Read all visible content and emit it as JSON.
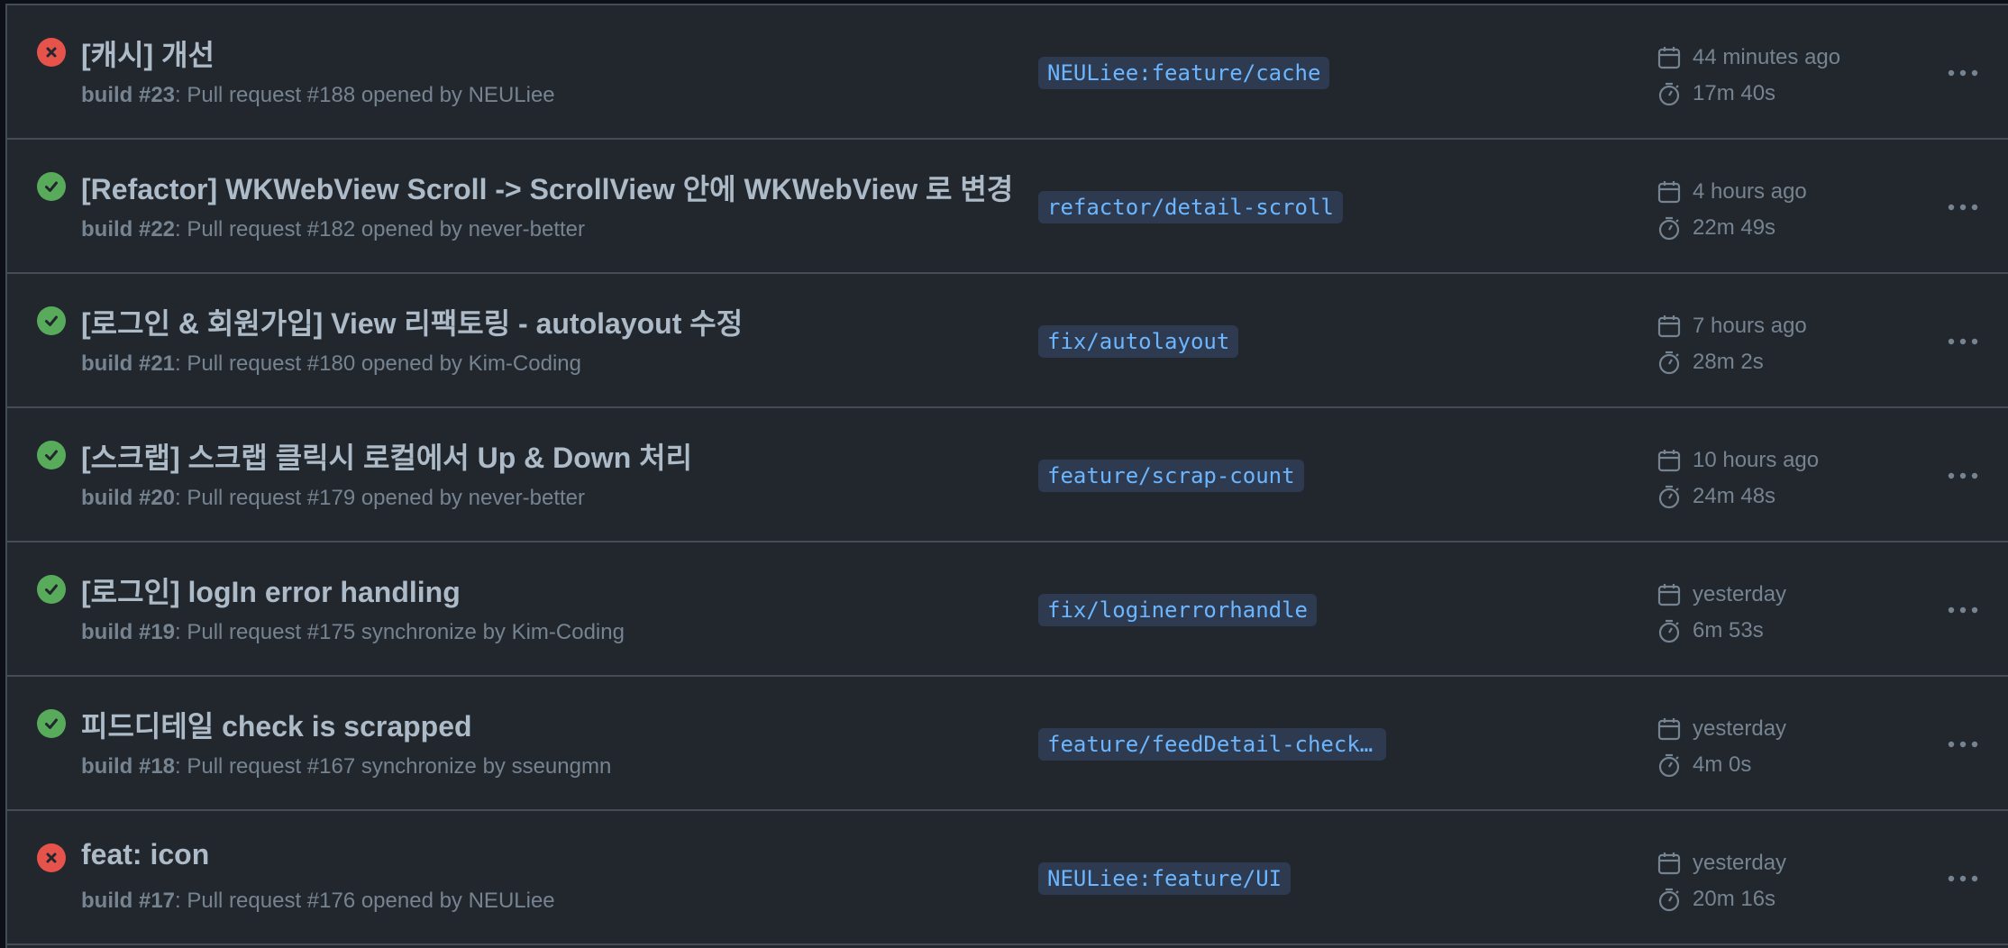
{
  "runs": [
    {
      "status": "failure",
      "status_icon": "x-circle-icon",
      "title": "[캐시] 개선",
      "build": "build #23",
      "event": ": Pull request #188 opened by NEULiee",
      "branch": "NEULiee:feature/cache",
      "time": "44 minutes ago",
      "duration": "17m 40s"
    },
    {
      "status": "success",
      "status_icon": "check-circle-icon",
      "title": "[Refactor] WKWebView Scroll -> ScrollView 안에 WKWebView 로 변경",
      "build": "build #22",
      "event": ": Pull request #182 opened by never-better",
      "branch": "refactor/detail-scroll",
      "time": "4 hours ago",
      "duration": "22m 49s"
    },
    {
      "status": "success",
      "status_icon": "check-circle-icon",
      "title": "[로그인 & 회원가입] View 리팩토링 - autolayout 수정",
      "build": "build #21",
      "event": ": Pull request #180 opened by Kim-Coding",
      "branch": "fix/autolayout",
      "time": "7 hours ago",
      "duration": "28m 2s"
    },
    {
      "status": "success",
      "status_icon": "check-circle-icon",
      "title": "[스크랩] 스크랩 클릭시 로컬에서 Up & Down 처리",
      "build": "build #20",
      "event": ": Pull request #179 opened by never-better",
      "branch": "feature/scrap-count",
      "time": "10 hours ago",
      "duration": "24m 48s"
    },
    {
      "status": "success",
      "status_icon": "check-circle-icon",
      "title": "[로그인] logIn error handling",
      "build": "build #19",
      "event": ": Pull request #175 synchronize by Kim-Coding",
      "branch": "fix/loginerrorhandle",
      "time": "yesterday",
      "duration": "6m 53s"
    },
    {
      "status": "success",
      "status_icon": "check-circle-icon",
      "title": "피드디테일 check is scrapped",
      "build": "build #18",
      "event": ": Pull request #167 synchronize by sseungmn",
      "branch": "feature/feedDetail-checkI…",
      "time": "yesterday",
      "duration": "4m 0s"
    },
    {
      "status": "failure",
      "status_icon": "x-circle-icon",
      "title": "feat: icon",
      "build": "build #17",
      "event": ": Pull request #176 opened by NEULiee",
      "branch": "NEULiee:feature/UI",
      "time": "yesterday",
      "duration": "20m 16s"
    }
  ],
  "icons": {
    "time": "calendar-icon",
    "duration": "stopwatch-icon",
    "more": "kebab-horizontal-icon"
  },
  "colors": {
    "success": "#57ab5a",
    "failure": "#e5534b",
    "branch_text": "#6cb6ff",
    "branch_bg": "#2d3a4f",
    "background": "#22272e"
  }
}
